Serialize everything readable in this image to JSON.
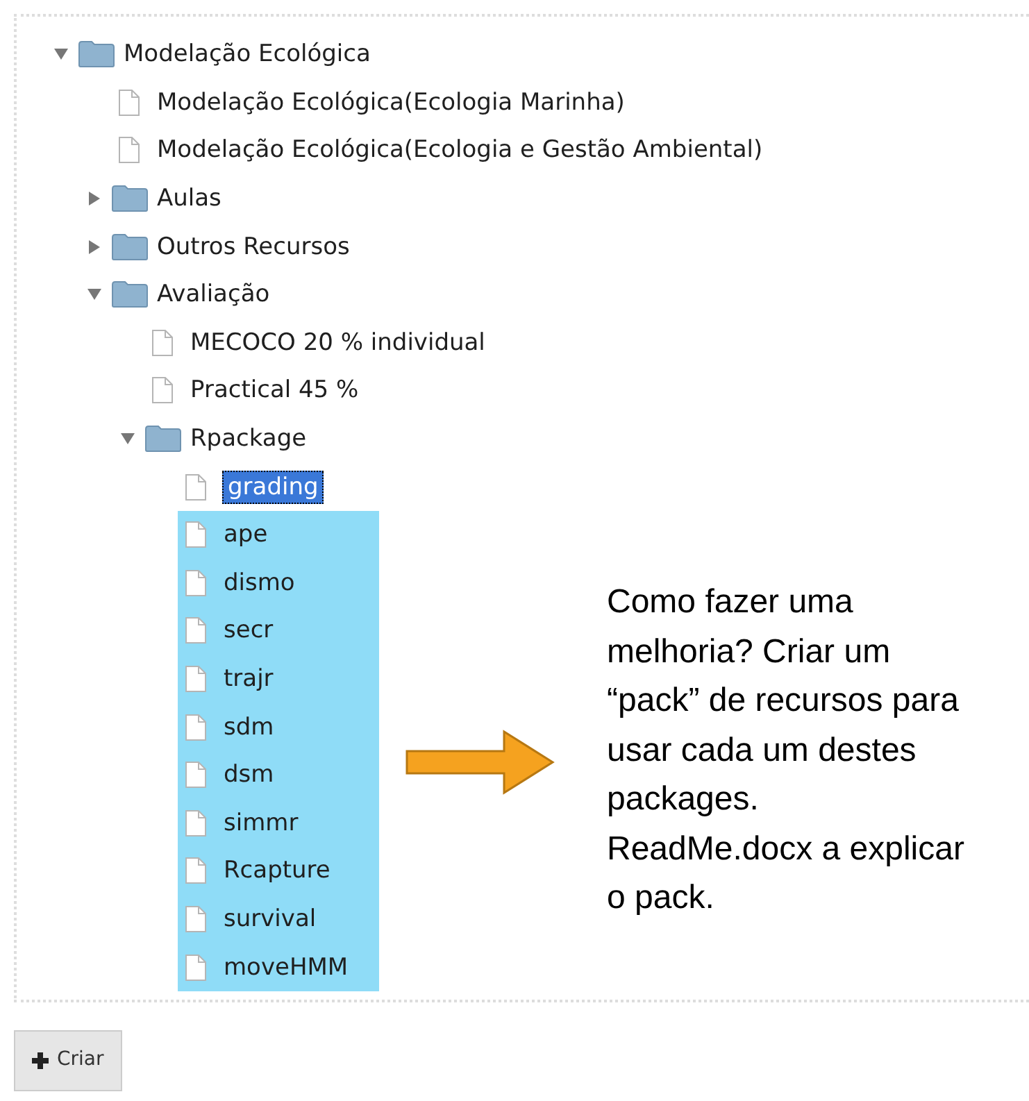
{
  "tree": [
    {
      "kind": "folder",
      "label": "Modelação Ecológica",
      "expanded": true,
      "selected": false,
      "highlighted": false,
      "children": [
        {
          "kind": "file",
          "label": "Modelação Ecológica(Ecologia Marinha)",
          "selected": false,
          "highlighted": false
        },
        {
          "kind": "file",
          "label": "Modelação Ecológica(Ecologia e Gestão Ambiental)",
          "selected": false,
          "highlighted": false
        },
        {
          "kind": "folder",
          "label": "Aulas",
          "expanded": false,
          "selected": false,
          "highlighted": false
        },
        {
          "kind": "folder",
          "label": "Outros Recursos",
          "expanded": false,
          "selected": false,
          "highlighted": false
        },
        {
          "kind": "folder",
          "label": "Avaliação",
          "expanded": true,
          "selected": false,
          "highlighted": false,
          "children": [
            {
              "kind": "file",
              "label": "MECOCO 20 % individual",
              "selected": false,
              "highlighted": false
            },
            {
              "kind": "file",
              "label": "Practical 45 %",
              "selected": false,
              "highlighted": false
            },
            {
              "kind": "folder",
              "label": "Rpackage",
              "expanded": true,
              "selected": false,
              "highlighted": false,
              "children": [
                {
                  "kind": "file",
                  "label": "grading",
                  "selected": true,
                  "highlighted": false
                },
                {
                  "kind": "file",
                  "label": "ape",
                  "selected": false,
                  "highlighted": true
                },
                {
                  "kind": "file",
                  "label": "dismo",
                  "selected": false,
                  "highlighted": true
                },
                {
                  "kind": "file",
                  "label": "secr",
                  "selected": false,
                  "highlighted": true
                },
                {
                  "kind": "file",
                  "label": "trajr",
                  "selected": false,
                  "highlighted": true
                },
                {
                  "kind": "file",
                  "label": "sdm",
                  "selected": false,
                  "highlighted": true
                },
                {
                  "kind": "file",
                  "label": "dsm",
                  "selected": false,
                  "highlighted": true
                },
                {
                  "kind": "file",
                  "label": "simmr",
                  "selected": false,
                  "highlighted": true
                },
                {
                  "kind": "file",
                  "label": "Rcapture",
                  "selected": false,
                  "highlighted": true
                },
                {
                  "kind": "file",
                  "label": "survival",
                  "selected": false,
                  "highlighted": true
                },
                {
                  "kind": "file",
                  "label": "moveHMM",
                  "selected": false,
                  "highlighted": true
                }
              ]
            }
          ]
        }
      ]
    }
  ],
  "annotation": "Como fazer uma melhoria? Criar um “pack” de recursos para usar cada um destes packages. ReadMe.docx a explicar o pack.",
  "create_button": "Criar"
}
